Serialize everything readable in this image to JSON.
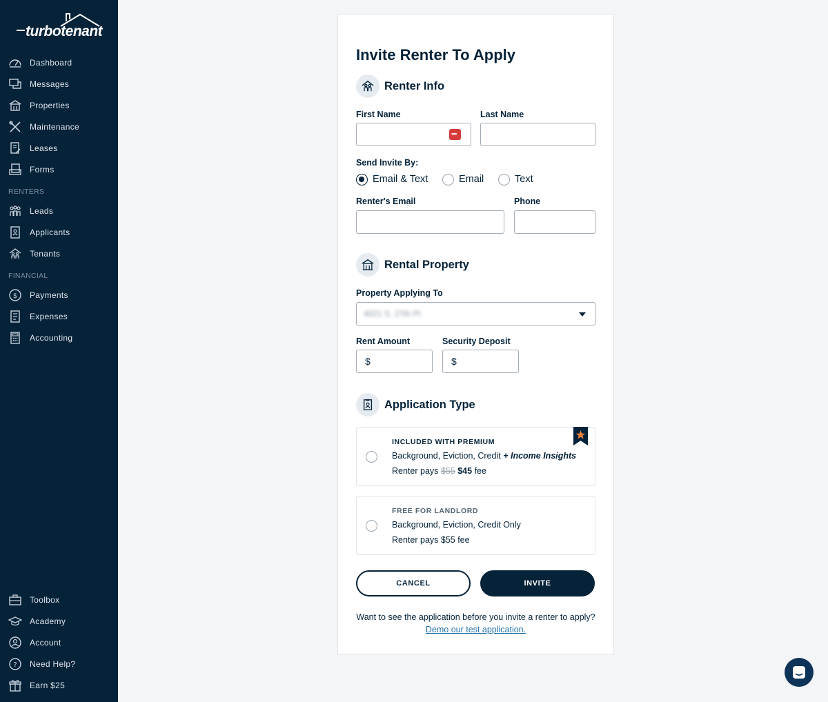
{
  "brand": {
    "name": "turbotenant"
  },
  "sidebar": {
    "items": [
      {
        "label": "Dashboard",
        "icon": "dashboard-icon"
      },
      {
        "label": "Messages",
        "icon": "messages-icon"
      },
      {
        "label": "Properties",
        "icon": "properties-icon"
      },
      {
        "label": "Maintenance",
        "icon": "maintenance-icon"
      },
      {
        "label": "Leases",
        "icon": "leases-icon"
      },
      {
        "label": "Forms",
        "icon": "forms-icon"
      }
    ],
    "renters_section": "RENTERS",
    "renters_items": [
      {
        "label": "Leads",
        "icon": "leads-icon"
      },
      {
        "label": "Applicants",
        "icon": "applicants-icon"
      },
      {
        "label": "Tenants",
        "icon": "tenants-icon"
      }
    ],
    "financial_section": "FINANCIAL",
    "financial_items": [
      {
        "label": "Payments",
        "icon": "payments-icon"
      },
      {
        "label": "Expenses",
        "icon": "expenses-icon"
      },
      {
        "label": "Accounting",
        "icon": "accounting-icon"
      }
    ],
    "bottom_items": [
      {
        "label": "Toolbox",
        "icon": "toolbox-icon"
      },
      {
        "label": "Academy",
        "icon": "academy-icon"
      },
      {
        "label": "Account",
        "icon": "account-icon"
      },
      {
        "label": "Need Help?",
        "icon": "help-icon"
      },
      {
        "label": "Earn $25",
        "icon": "gift-icon"
      }
    ]
  },
  "form": {
    "title": "Invite Renter To Apply",
    "renter_info": {
      "heading": "Renter Info",
      "first_name_label": "First Name",
      "first_name_value": "",
      "last_name_label": "Last Name",
      "last_name_value": "",
      "send_invite_label": "Send Invite By:",
      "send_options": [
        "Email & Text",
        "Email",
        "Text"
      ],
      "send_selected": "Email & Text",
      "email_label": "Renter's Email",
      "email_value": "",
      "phone_label": "Phone",
      "phone_value": ""
    },
    "rental_property": {
      "heading": "Rental Property",
      "property_label": "Property Applying To",
      "property_value": "4021 S. 27th Pl",
      "rent_label": "Rent Amount",
      "deposit_label": "Security Deposit",
      "currency_symbol": "$"
    },
    "application_type": {
      "heading": "Application Type",
      "options": [
        {
          "tag": "INCLUDED WITH PREMIUM",
          "desc": "Background, Eviction, Credit",
          "desc_extra": "+ Income Insights",
          "price_prefix": "Renter pays",
          "old_price": "$55",
          "new_price": "$45",
          "price_suffix": "fee",
          "selected": false
        },
        {
          "tag": "FREE FOR LANDLORD",
          "desc": "Background, Eviction, Credit Only",
          "price_text": "Renter pays $55 fee",
          "selected": false
        }
      ]
    },
    "cancel_label": "CANCEL",
    "invite_label": "INVITE",
    "footer_text": "Want to see the application before you invite a renter to apply?",
    "footer_link": "Demo our test application."
  },
  "colors": {
    "navy": "#042238",
    "link": "#2370a8",
    "accent": "#e8833a",
    "danger": "#d63a3a"
  }
}
